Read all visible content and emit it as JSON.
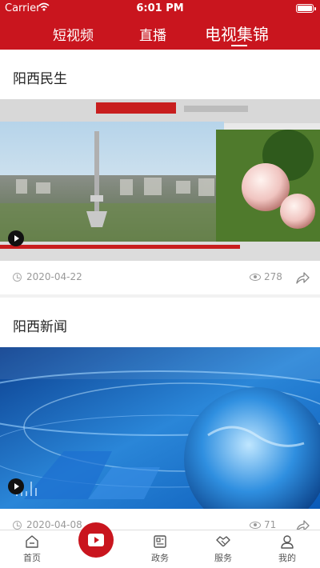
{
  "status_bar": {
    "carrier": "Carrier",
    "time": "6:01 PM"
  },
  "tabs": [
    {
      "label": "短视频"
    },
    {
      "label": "直播"
    },
    {
      "label": "电视集锦",
      "active": true
    }
  ],
  "sections": [
    {
      "title": "阳西民生",
      "date": "2020-04-22",
      "views": "278"
    },
    {
      "title": "阳西新闻",
      "date": "2020-04-08",
      "views": "71"
    }
  ],
  "bottom_nav": [
    {
      "label": "首页",
      "icon": "home-icon"
    },
    {
      "label": "",
      "icon": "video-play-icon"
    },
    {
      "label": "政务",
      "icon": "news-icon"
    },
    {
      "label": "服务",
      "icon": "handshake-icon"
    },
    {
      "label": "我的",
      "icon": "user-icon"
    }
  ],
  "colors": {
    "brand": "#c9151e",
    "meta_text": "#999999"
  }
}
